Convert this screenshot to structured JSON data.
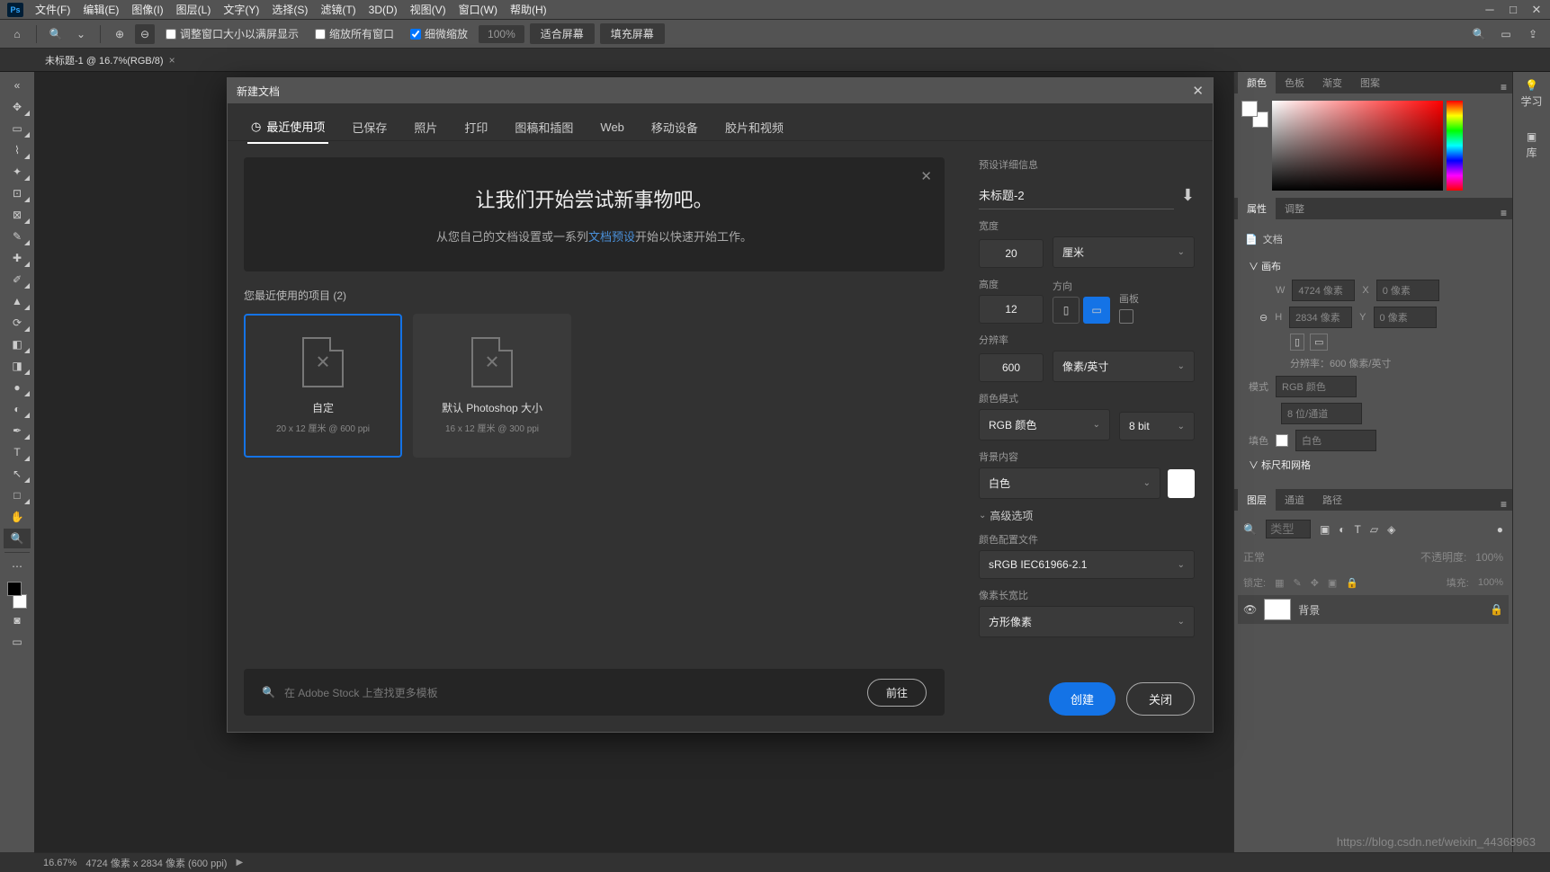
{
  "menubar": {
    "items": [
      "文件(F)",
      "编辑(E)",
      "图像(I)",
      "图层(L)",
      "文字(Y)",
      "选择(S)",
      "滤镜(T)",
      "3D(D)",
      "视图(V)",
      "窗口(W)",
      "帮助(H)"
    ]
  },
  "options_bar": {
    "check1": "调整窗口大小以满屏显示",
    "check2": "缩放所有窗口",
    "check3": "细微缩放",
    "zoom_pct": "100%",
    "fit_screen": "适合屏幕",
    "fill_screen": "填充屏幕"
  },
  "doc_tab": "未标题-1 @ 16.7%(RGB/8)",
  "far_right": {
    "learn": "学习",
    "library": "库"
  },
  "panels": {
    "color_tabs": [
      "颜色",
      "色板",
      "渐变",
      "图案"
    ],
    "props_tabs": [
      "属性",
      "调整"
    ],
    "props_doc": "文档",
    "canvas_hdr": "画布",
    "W": "W",
    "W_val": "4724 像素",
    "X": "X",
    "X_val": "0 像素",
    "H": "H",
    "H_val": "2834 像素",
    "Y": "Y",
    "Y_val": "0 像素",
    "res": "分辨率：600 像素/英寸",
    "mode_label": "模式",
    "mode_val": "RGB 颜色",
    "bits_val": "8 位/通道",
    "fill_label": "填色",
    "fill_val": "白色",
    "ruler_hdr": "标尺和网格",
    "layers_tabs": [
      "图层",
      "通道",
      "路径"
    ],
    "search_placeholder": "类型",
    "blend": "正常",
    "opacity_label": "不透明度:",
    "opacity_val": "100%",
    "lock_label": "锁定:",
    "fill_opacity_label": "填充:",
    "fill_opacity_val": "100%",
    "layer_name": "背景"
  },
  "dialog": {
    "title": "新建文档",
    "tabs": [
      "最近使用项",
      "已保存",
      "照片",
      "打印",
      "图稿和插图",
      "Web",
      "移动设备",
      "胶片和视频"
    ],
    "banner_title": "让我们开始尝试新事物吧。",
    "banner_text_before": "从您自己的文档设置或一系列",
    "banner_link": "文档预设",
    "banner_text_after": "开始以快速开始工作。",
    "recent_label": "您最近使用的项目 (2)",
    "presets": [
      {
        "name": "自定",
        "desc": "20 x 12 厘米 @ 600 ppi"
      },
      {
        "name": "默认 Photoshop 大小",
        "desc": "16 x 12 厘米 @ 300 ppi"
      }
    ],
    "stock_placeholder": "在 Adobe Stock 上查找更多模板",
    "go_btn": "前往",
    "details_title": "预设详细信息",
    "doc_name": "未标题-2",
    "width_label": "宽度",
    "width_val": "20",
    "width_unit": "厘米",
    "height_label": "高度",
    "height_val": "12",
    "orient_label": "方向",
    "artboard_label": "画板",
    "res_label": "分辨率",
    "res_val": "600",
    "res_unit": "像素/英寸",
    "color_mode_label": "颜色模式",
    "color_mode_val": "RGB 颜色",
    "color_bits": "8 bit",
    "bg_label": "背景内容",
    "bg_val": "白色",
    "adv_label": "高级选项",
    "profile_label": "颜色配置文件",
    "profile_val": "sRGB IEC61966-2.1",
    "aspect_label": "像素长宽比",
    "aspect_val": "方形像素",
    "create_btn": "创建",
    "close_btn": "关闭"
  },
  "status": {
    "zoom": "16.67%",
    "dims": "4724 像素 x 2834 像素 (600 ppi)"
  },
  "watermark": "https://blog.csdn.net/weixin_44368963"
}
